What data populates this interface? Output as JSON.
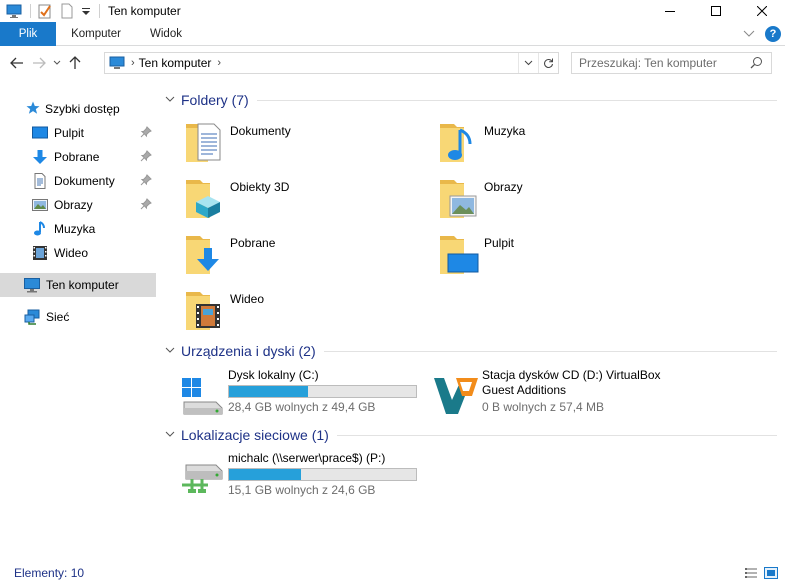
{
  "window": {
    "title": "Ten komputer"
  },
  "ribbon": {
    "tabs": [
      "Plik",
      "Komputer",
      "Widok"
    ]
  },
  "address": {
    "path": "Ten komputer",
    "search_placeholder": "Przeszukaj: Ten komputer"
  },
  "sidebar": {
    "items": [
      {
        "label": "Szybki dostęp",
        "icon": "star-icon"
      },
      {
        "label": "Pulpit",
        "icon": "desktop-icon",
        "pinned": true
      },
      {
        "label": "Pobrane",
        "icon": "download-icon",
        "pinned": true
      },
      {
        "label": "Dokumenty",
        "icon": "document-icon",
        "pinned": true
      },
      {
        "label": "Obrazy",
        "icon": "picture-icon",
        "pinned": true
      },
      {
        "label": "Muzyka",
        "icon": "music-icon"
      },
      {
        "label": "Wideo",
        "icon": "video-icon"
      },
      {
        "label": "Ten komputer",
        "icon": "computer-icon",
        "selected": true
      },
      {
        "label": "Sieć",
        "icon": "network-icon"
      }
    ]
  },
  "groups": {
    "folders": {
      "title": "Foldery (7)"
    },
    "drives": {
      "title": "Urządzenia i dyski (2)"
    },
    "network": {
      "title": "Lokalizacje sieciowe (1)"
    }
  },
  "folders": [
    {
      "label": "Dokumenty",
      "icon": "documents-folder-icon"
    },
    {
      "label": "Muzyka",
      "icon": "music-folder-icon"
    },
    {
      "label": "Obiekty 3D",
      "icon": "3d-objects-folder-icon"
    },
    {
      "label": "Obrazy",
      "icon": "pictures-folder-icon"
    },
    {
      "label": "Pobrane",
      "icon": "downloads-folder-icon"
    },
    {
      "label": "Pulpit",
      "icon": "desktop-folder-icon"
    },
    {
      "label": "Wideo",
      "icon": "videos-folder-icon"
    }
  ],
  "drives": [
    {
      "name": "Dysk lokalny (C:)",
      "free": "28,4 GB wolnych z 49,4 GB",
      "used_fraction": 0.425,
      "icon": "windows-drive-icon"
    },
    {
      "name_line1": "Stacja dysków CD (D:) VirtualBox",
      "name_line2": "Guest Additions",
      "free": "0 B wolnych z 57,4 MB",
      "icon": "virtualbox-cd-icon"
    }
  ],
  "network_drives": [
    {
      "name": "michalc (\\\\serwer\\prace$) (P:)",
      "free": "15,1 GB wolnych z 24,6 GB",
      "used_fraction": 0.386,
      "icon": "network-drive-icon"
    }
  ],
  "status": {
    "count": "Elementy: 10"
  },
  "colors": {
    "accent": "#1979ca",
    "group_title": "#1e3287",
    "bar_fill": "#26a0da",
    "selected_bg": "#d9d9d9"
  }
}
